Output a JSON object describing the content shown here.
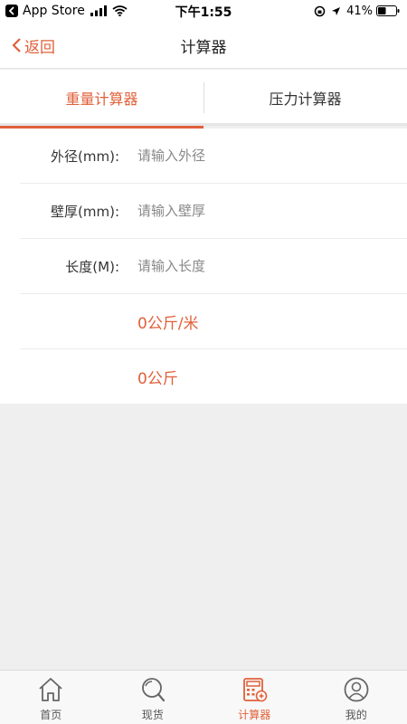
{
  "status_bar": {
    "app": "App Store",
    "time": "下午1:55",
    "battery": "41%"
  },
  "nav": {
    "back_label": "返回",
    "title": "计算器"
  },
  "tabs": [
    {
      "label": "重量计算器",
      "active": true
    },
    {
      "label": "压力计算器",
      "active": false
    }
  ],
  "form": {
    "outer_diameter": {
      "label": "外径(mm):",
      "placeholder": "请输入外径"
    },
    "wall_thickness": {
      "label": "壁厚(mm):",
      "placeholder": "请输入壁厚"
    },
    "length": {
      "label": "长度(M):",
      "placeholder": "请输入长度"
    },
    "result_per_meter": "0公斤/米",
    "result_total": "0公斤"
  },
  "bottom_tabs": [
    {
      "label": "首页",
      "icon": "home-icon",
      "active": false
    },
    {
      "label": "现货",
      "icon": "search-icon",
      "active": false
    },
    {
      "label": "计算器",
      "icon": "calculator-icon",
      "active": true
    },
    {
      "label": "我的",
      "icon": "user-icon",
      "active": false
    }
  ],
  "colors": {
    "accent": "#e0603a",
    "background": "#efefef"
  }
}
